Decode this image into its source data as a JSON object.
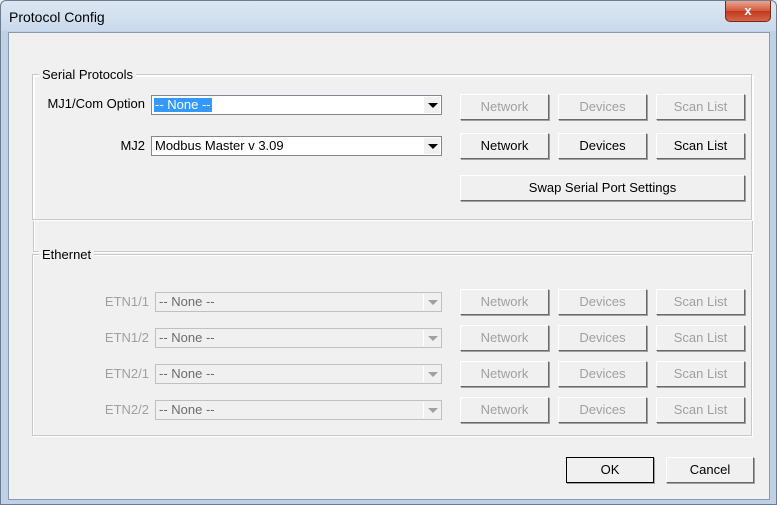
{
  "window": {
    "title": "Protocol Config",
    "close_label": "x"
  },
  "serial": {
    "group_label": "Serial Protocols",
    "rows": [
      {
        "label": "MJ1/Com Option",
        "value": "-- None --",
        "network": "Network",
        "devices": "Devices",
        "scan_list": "Scan List"
      },
      {
        "label": "MJ2",
        "value": "Modbus Master  v 3.09",
        "network": "Network",
        "devices": "Devices",
        "scan_list": "Scan List"
      }
    ],
    "swap_label": "Swap Serial Port Settings"
  },
  "ethernet": {
    "group_label": "Ethernet",
    "rows": [
      {
        "label": "ETN1/1",
        "value": "-- None --",
        "network": "Network",
        "devices": "Devices",
        "scan_list": "Scan List"
      },
      {
        "label": "ETN1/2",
        "value": "-- None --",
        "network": "Network",
        "devices": "Devices",
        "scan_list": "Scan List"
      },
      {
        "label": "ETN2/1",
        "value": "-- None --",
        "network": "Network",
        "devices": "Devices",
        "scan_list": "Scan List"
      },
      {
        "label": "ETN2/2",
        "value": "-- None --",
        "network": "Network",
        "devices": "Devices",
        "scan_list": "Scan List"
      }
    ]
  },
  "footer": {
    "ok_label": "OK",
    "cancel_label": "Cancel"
  },
  "colors": {
    "selection": "#3399ff",
    "disabled_text": "#a0a0a0",
    "close_button": "#c3391c"
  }
}
